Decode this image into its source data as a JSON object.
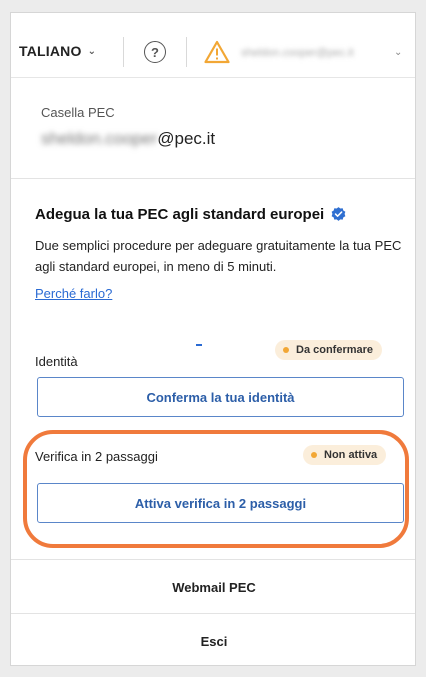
{
  "header": {
    "language": "TALIANO",
    "help_glyph": "?",
    "account_email_blurred": "sheldon.cooper@pec.it",
    "icons": [
      "chevron-down-icon",
      "help-icon",
      "warning-icon"
    ],
    "warning_color": "#f2a735"
  },
  "mailbox": {
    "label": "Casella PEC",
    "email_local_blurred": "sheldon.cooper",
    "email_domain": "@pec.it"
  },
  "adegua": {
    "title": "Adegua la tua PEC agli standard europei",
    "description": "Due semplici procedure per adeguare gratuitamente la tua PEC agli standard europei, in meno di 5 minuti.",
    "link": "Perché farlo?",
    "icon": "verified-badge-icon"
  },
  "identity": {
    "label": "Identità",
    "status": "Da confermare",
    "button": "Conferma la tua identità"
  },
  "two_step": {
    "label": "Verifica in 2 passaggi",
    "status": "Non attiva",
    "button": "Attiva verifica in 2 passaggi"
  },
  "menu": {
    "webmail": "Webmail PEC",
    "logout": "Esci"
  },
  "colors": {
    "accent": "#2c5ea8",
    "link": "#2a6ad3",
    "status_pill_bg": "#fbeedb",
    "status_dot": "#f2a735",
    "highlight": "#f07a3c"
  }
}
